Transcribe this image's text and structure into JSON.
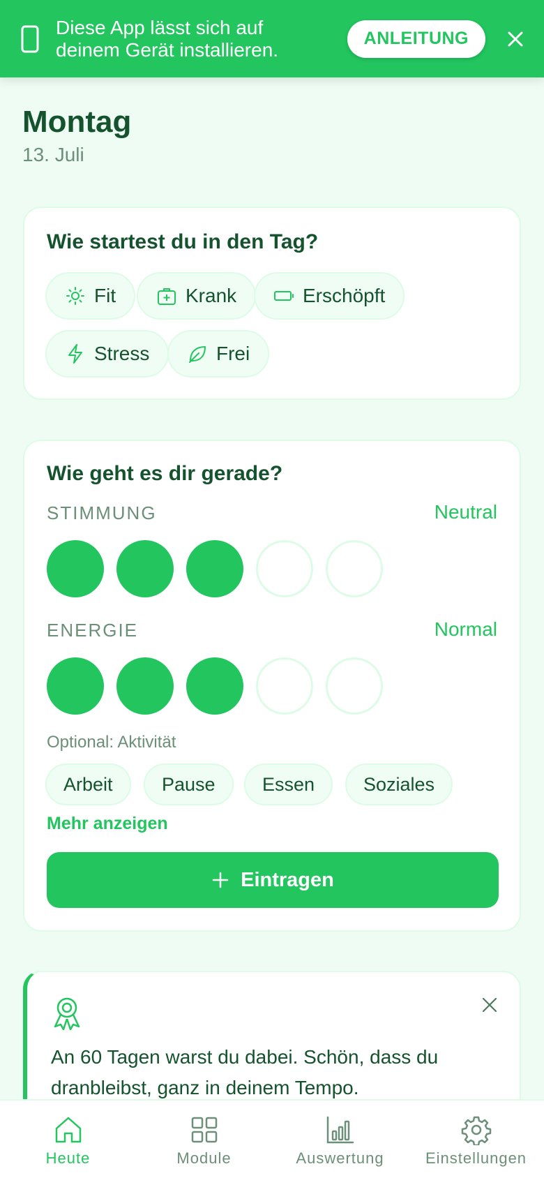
{
  "banner": {
    "text_line1": "Diese App lässt sich auf",
    "text_line2": "deinem Gerät installieren.",
    "guide_label": "ANLEITUNG"
  },
  "header": {
    "day": "Montag",
    "date": "13. Juli"
  },
  "start_card": {
    "title": "Wie startest du in den Tag?",
    "options": [
      {
        "label": "Fit",
        "icon": "sun-icon"
      },
      {
        "label": "Krank",
        "icon": "medkit-icon"
      },
      {
        "label": "Erschöpft",
        "icon": "battery-low-icon"
      },
      {
        "label": "Stress",
        "icon": "lightning-icon"
      },
      {
        "label": "Frei",
        "icon": "leaf-icon"
      }
    ]
  },
  "mood_card": {
    "title": "Wie geht es dir gerade?",
    "mood": {
      "label": "STIMMUNG",
      "value": "Neutral",
      "level": 3,
      "max": 5
    },
    "energy": {
      "label": "ENERGIE",
      "value": "Normal",
      "level": 3,
      "max": 5
    },
    "optional_label": "Optional: Aktivität",
    "activities": [
      "Arbeit",
      "Pause",
      "Essen",
      "Soziales"
    ],
    "more_label": "Mehr anzeigen",
    "submit_label": "Eintragen"
  },
  "streak_card": {
    "icon": "award-icon",
    "line1": "An 60 Tagen warst du dabei. Schön, dass du",
    "line2": "dranbleibst, ganz in deinem Tempo."
  },
  "nav": {
    "items": [
      {
        "label": "Heute",
        "icon": "home-icon",
        "active": true
      },
      {
        "label": "Module",
        "icon": "grid-icon",
        "active": false
      },
      {
        "label": "Auswertung",
        "icon": "bar-chart-icon",
        "active": false
      },
      {
        "label": "Einstellungen",
        "icon": "gear-icon",
        "active": false
      }
    ]
  },
  "colors": {
    "accent": "#22c55e",
    "text_dark": "#14532d",
    "text_muted": "#6b8f78",
    "background": "#effcf4",
    "border": "#dcfce7"
  }
}
